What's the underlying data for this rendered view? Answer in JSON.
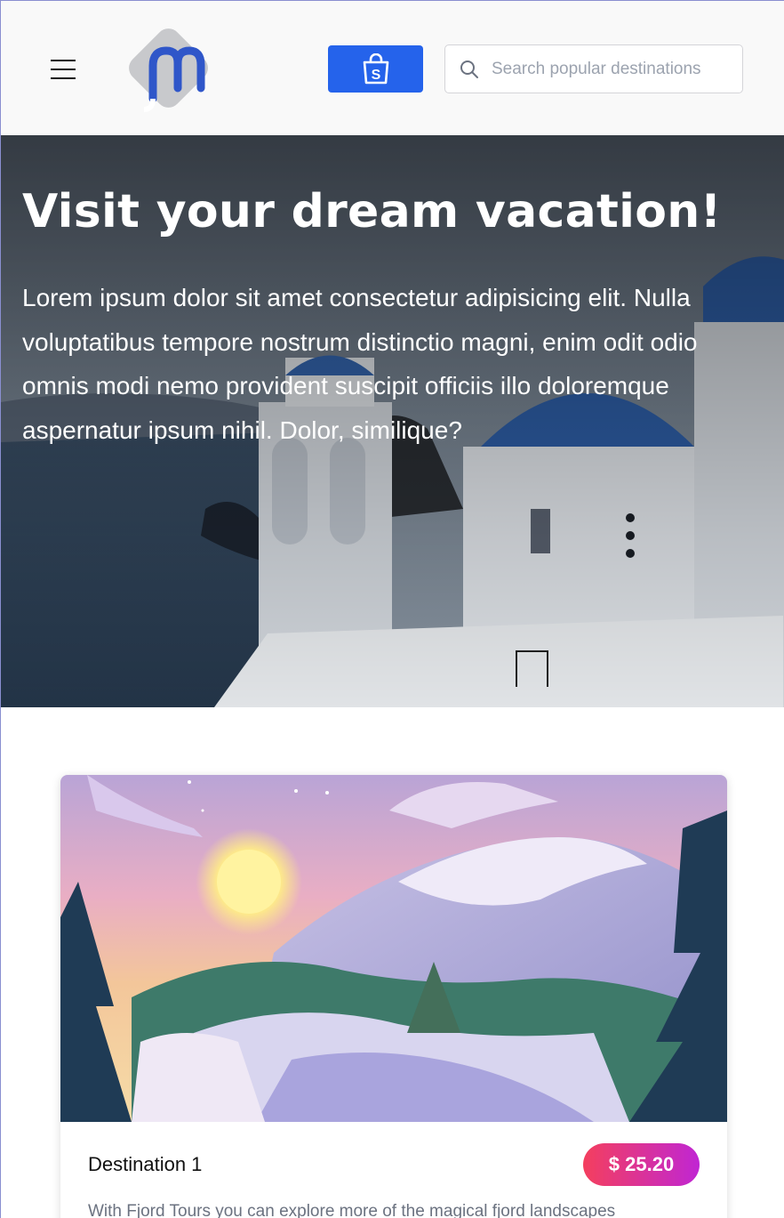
{
  "header": {
    "menu_icon": "hamburger-icon",
    "logo_icon": "m-logo",
    "cart_icon": "shopping-bag-icon",
    "search": {
      "placeholder": "Search popular destinations",
      "value": ""
    },
    "accent": "#2563eb"
  },
  "hero": {
    "title": "Visit your dream vacation!",
    "body": "Lorem ipsum dolor sit amet consectetur adipisicing elit. Nulla voluptatibus tempore nostrum distinctio magni, enim odit odio omnis modi nemo provident suscipit officiis illo doloremque aspernatur ipsum nihil. Dolor, similique?"
  },
  "cards": [
    {
      "title": "Destination 1",
      "price": "$ 25.20",
      "description": "With Fjord Tours you can explore more of the magical fjord landscapes"
    }
  ]
}
